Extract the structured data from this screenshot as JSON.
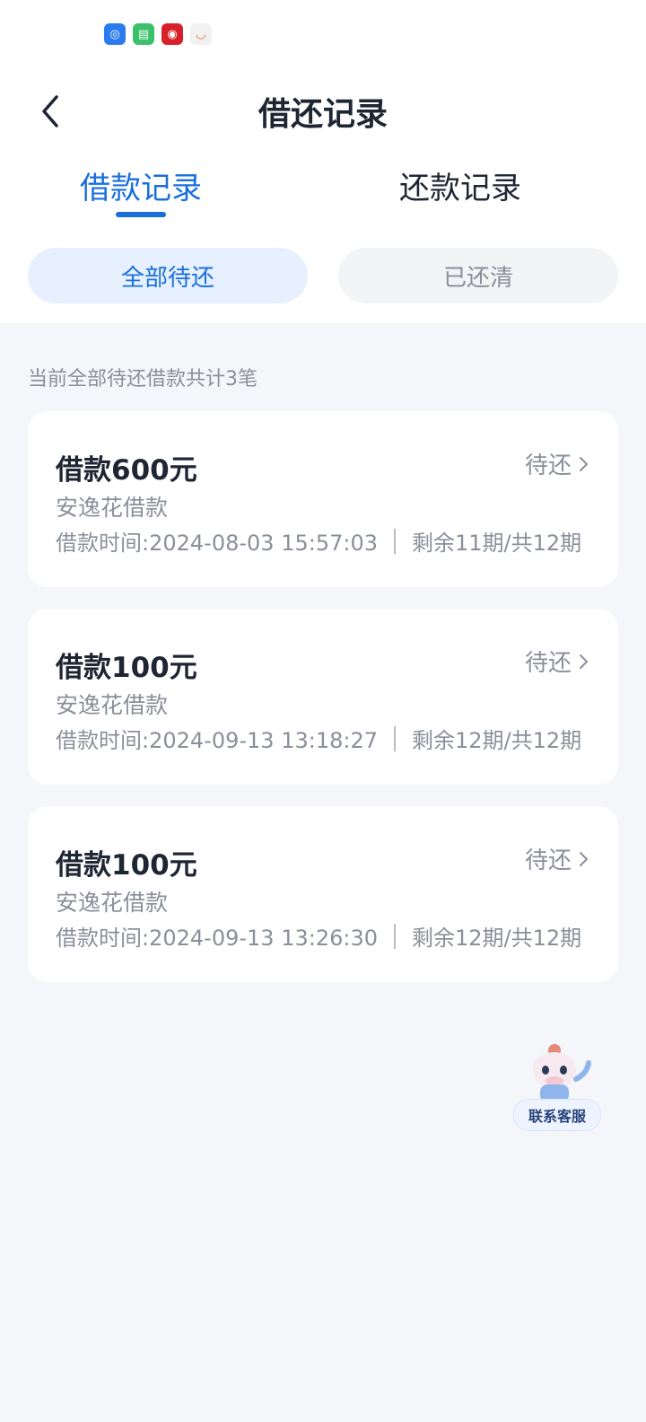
{
  "status_bar": {
    "app_icons": [
      "app-icon-blue",
      "messages-icon",
      "weibo-icon",
      "shop-icon"
    ]
  },
  "header": {
    "title": "借还记录"
  },
  "tabs": [
    {
      "label": "借款记录",
      "active": true
    },
    {
      "label": "还款记录",
      "active": false
    }
  ],
  "filters": [
    {
      "label": "全部待还",
      "active": true
    },
    {
      "label": "已还清",
      "active": false
    }
  ],
  "summary": "当前全部待还借款共计3笔",
  "loans": [
    {
      "amount": "借款600元",
      "status": "待还",
      "product": "安逸花借款",
      "time": "借款时间:2024-08-03 15:57:03",
      "terms": "剩余11期/共12期"
    },
    {
      "amount": "借款100元",
      "status": "待还",
      "product": "安逸花借款",
      "time": "借款时间:2024-09-13 13:18:27",
      "terms": "剩余12期/共12期"
    },
    {
      "amount": "借款100元",
      "status": "待还",
      "product": "安逸花借款",
      "time": "借款时间:2024-09-13 13:26:30",
      "terms": "剩余12期/共12期"
    }
  ],
  "customer_service": {
    "label": "联系客服"
  },
  "colors": {
    "accent": "#1a6fdc",
    "background": "#f4f6f9",
    "text": "#1f2633",
    "muted": "#8a8f99"
  }
}
